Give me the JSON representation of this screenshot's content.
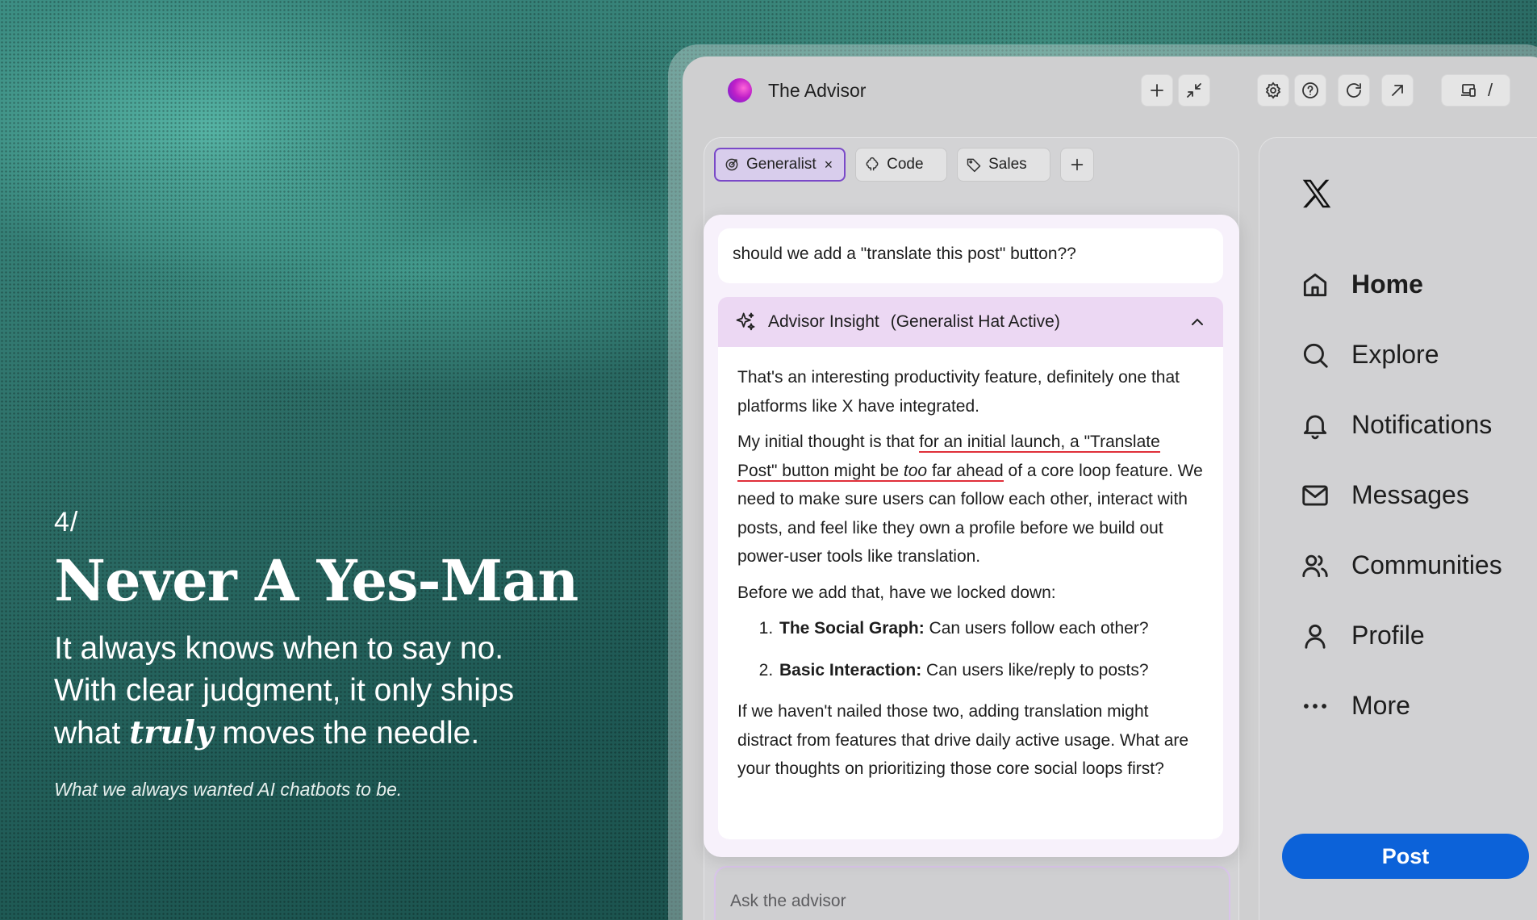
{
  "promo": {
    "number": "4/",
    "headline": "Never A Yes-Man",
    "line1": "It always knows when to say no.",
    "line2": "With clear judgment, it only ships",
    "line3_pre": "what ",
    "line3_em": "truly",
    "line3_post": " moves the needle.",
    "tagline": "What we always wanted AI chatbots to be."
  },
  "window": {
    "title": "The Advisor",
    "toolbar_icons": [
      "plus-icon",
      "collapse-icon",
      "gear-icon",
      "help-icon",
      "refresh-icon",
      "external-link-icon",
      "devices-icon"
    ],
    "shortcut_key": "/"
  },
  "tabs": [
    {
      "label": "Generalist",
      "icon": "target-icon",
      "active": true,
      "close": "×"
    },
    {
      "label": "Code",
      "icon": "brain-icon",
      "active": false
    },
    {
      "label": "Sales",
      "icon": "tag-icon",
      "active": false
    }
  ],
  "chat": {
    "user_message": "should we add a \"translate this post\" button??",
    "insight_title": "Advisor Insight",
    "insight_hat": "(Generalist Hat Active)",
    "para1": "That's an interesting productivity feature, definitely one that platforms like X have integrated.",
    "para2_pre": "My initial thought is that ",
    "para2_ul1": "for an initial launch, a \"Translate Post\" button might be ",
    "para2_em": "too",
    "para2_ul2": " far ahead",
    "para2_post": " of a core loop feature. We need to make sure users can follow each other, interact with posts, and feel like they own a profile before we build out power-user tools like translation.",
    "para3": "Before we add that, have we locked down:",
    "list": [
      {
        "bold": "The Social Graph:",
        "text": " Can users follow each other?"
      },
      {
        "bold": "Basic Interaction:",
        "text": " Can users like/reply to posts?"
      }
    ],
    "para4": "If we haven't nailed those two, adding translation might distract from features that drive daily active usage. What are your thoughts on prioritizing those core social loops first?",
    "input_placeholder": "Ask the advisor"
  },
  "x_sidebar": {
    "logo": "x-logo-icon",
    "items": [
      {
        "label": "Home",
        "icon": "home-icon"
      },
      {
        "label": "Explore",
        "icon": "search-icon"
      },
      {
        "label": "Notifications",
        "icon": "bell-icon"
      },
      {
        "label": "Messages",
        "icon": "mail-icon"
      },
      {
        "label": "Communities",
        "icon": "people-icon"
      },
      {
        "label": "Profile",
        "icon": "person-icon"
      },
      {
        "label": "More",
        "icon": "more-icon"
      }
    ],
    "post_label": "Post"
  },
  "colors": {
    "accent_purple": "#7a49c8",
    "post_blue": "#0c62d9",
    "underline_red": "#e0303a",
    "insight_header": "#ecd8f3"
  }
}
